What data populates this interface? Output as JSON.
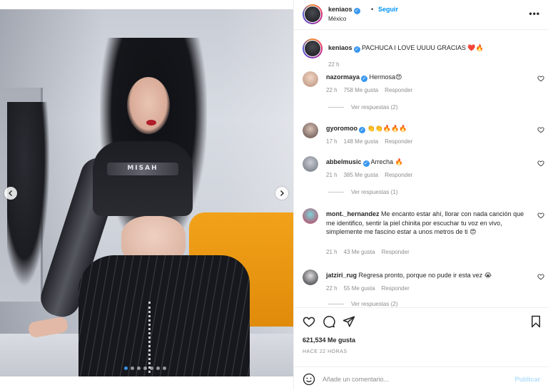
{
  "header": {
    "username": "keniaos",
    "separator": "•",
    "follow_label": "Seguir",
    "location": "México",
    "more_icon": "more-horizontal-icon"
  },
  "media": {
    "shirt_text": "MISAH",
    "total_slides": 7,
    "active_slide": 1
  },
  "caption": {
    "username": "keniaos",
    "text": "PACHUCA I LOVE UUUU GRACIAS ❤️🔥",
    "time": "22 h"
  },
  "comments": [
    {
      "username": "nazormaya",
      "verified": true,
      "text": "Hermosa😍",
      "time": "22 h",
      "likes": "758 Me gusta",
      "reply": "Responder",
      "view_replies": "Ver respuestas (2)"
    },
    {
      "username": "gyoromoo",
      "verified": true,
      "text": "👏👏🔥🔥🔥",
      "time": "17 h",
      "likes": "148 Me gusta",
      "reply": "Responder",
      "view_replies": ""
    },
    {
      "username": "abbelmusic",
      "verified": true,
      "text": "Arrecha 🔥",
      "time": "21 h",
      "likes": "385 Me gusta",
      "reply": "Responder",
      "view_replies": "Ver respuestas (1)"
    },
    {
      "username": "mont._hernandez",
      "verified": false,
      "text": "Me encanto estar ahí, llorar con nada canción que me identifico, sentir la piel chinita por escuchar tu voz en vivo, simplemente me fascino estar a unos metros de ti 😍",
      "time": "21 h",
      "likes": "43 Me gusta",
      "reply": "Responder",
      "view_replies": ""
    },
    {
      "username": "jatziri_rug",
      "verified": false,
      "text": "Regresa pronto, porque no pude ir esta vez 😭",
      "time": "22 h",
      "likes": "55 Me gusta",
      "reply": "Responder",
      "view_replies": "Ver respuestas (2)"
    }
  ],
  "actions": {
    "likes_count": "621,534 Me gusta",
    "posted_ago": "HACE 22 HORAS"
  },
  "add_comment": {
    "placeholder": "Añade un comentario...",
    "publish_label": "Publicar"
  },
  "colors": {
    "accent": "#0095f6",
    "verified": "#3897f0",
    "muted_text": "#8e8e8e",
    "publish_disabled": "#b2dffc",
    "active_dot": "#3a94e6"
  }
}
